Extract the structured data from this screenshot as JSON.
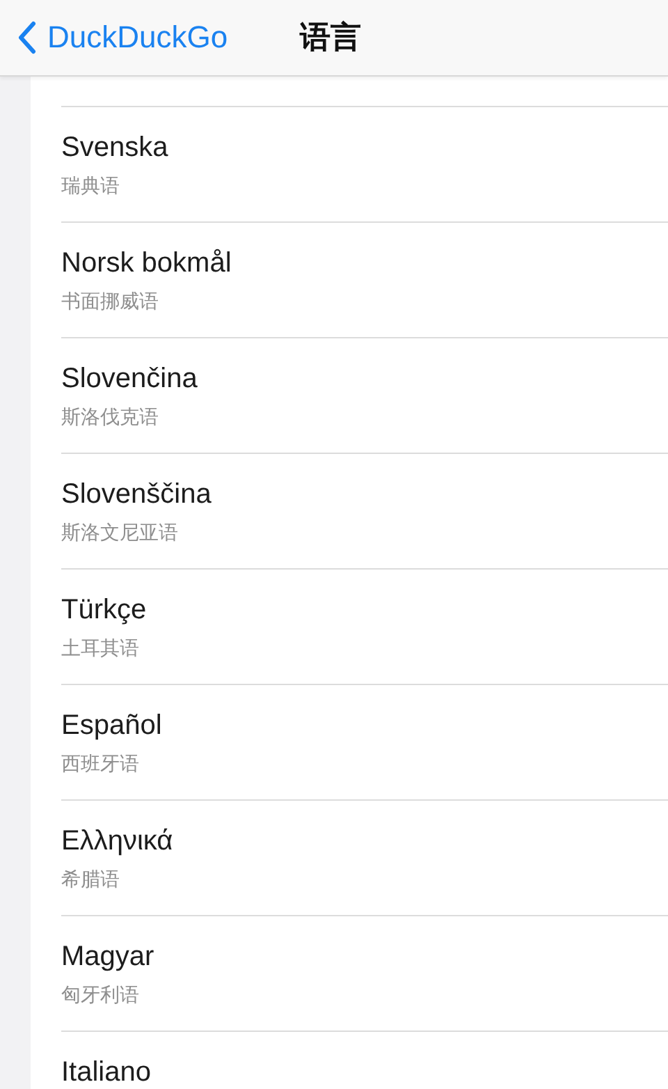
{
  "nav_bar": {
    "back_label": "DuckDuckGo",
    "title": "语言"
  },
  "languages": [
    {
      "name": "Svenska",
      "translation": "瑞典语"
    },
    {
      "name": "Norsk bokmål",
      "translation": "书面挪威语"
    },
    {
      "name": "Slovenčina",
      "translation": "斯洛伐克语"
    },
    {
      "name": "Slovenščina",
      "translation": "斯洛文尼亚语"
    },
    {
      "name": "Türkçe",
      "translation": "土耳其语"
    },
    {
      "name": "Español",
      "translation": "西班牙语"
    },
    {
      "name": "Ελληνικά",
      "translation": "希腊语"
    },
    {
      "name": "Magyar",
      "translation": "匈牙利语"
    },
    {
      "name": "Italiano"
    }
  ]
}
